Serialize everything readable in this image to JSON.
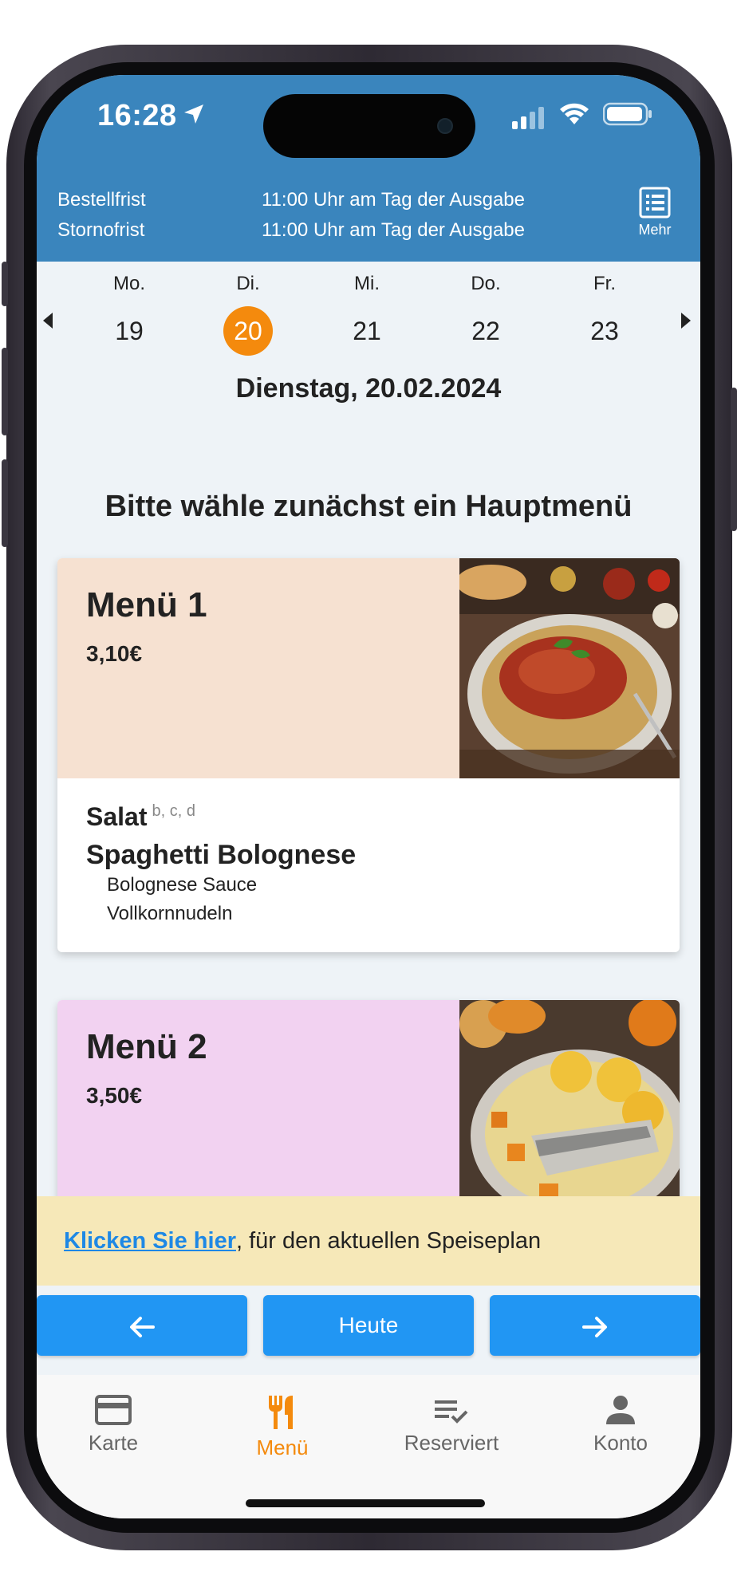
{
  "status_bar": {
    "time": "16:28"
  },
  "header": {
    "order_deadline_label": "Bestellfrist",
    "order_deadline_value": "11:00 Uhr am Tag der Ausgabe",
    "cancel_deadline_label": "Stornofrist",
    "cancel_deadline_value": "11:00 Uhr am Tag der Ausgabe",
    "more_label": "Mehr"
  },
  "week": {
    "days": [
      {
        "name": "Mo.",
        "date": "19"
      },
      {
        "name": "Di.",
        "date": "20",
        "selected": true
      },
      {
        "name": "Mi.",
        "date": "21"
      },
      {
        "name": "Do.",
        "date": "22"
      },
      {
        "name": "Fr.",
        "date": "23"
      }
    ],
    "selected_date_label": "Dienstag, 20.02.2024"
  },
  "prompt": "Bitte wähle zunächst ein Hauptmenü",
  "menus": [
    {
      "name": "Menü 1",
      "price": "3,10€",
      "color": "#f6e1d1",
      "image_icon": "spaghetti-bolognese-photo",
      "side": "Salat",
      "allergens": "b, c, d",
      "main": "Spaghetti Bolognese",
      "components": [
        "Bolognese Sauce",
        "Vollkornnudeln"
      ]
    },
    {
      "name": "Menü 2",
      "price": "3,50€",
      "color": "#f2d2f1",
      "image_icon": "fish-pumpkin-photo"
    }
  ],
  "notice": {
    "link_text": "Klicken Sie hier",
    "text": ", für den aktuellen Speiseplan"
  },
  "nav_buttons": {
    "prev_icon": "arrow-left-icon",
    "today_label": "Heute",
    "next_icon": "arrow-right-icon"
  },
  "tabs": [
    {
      "label": "Karte",
      "icon": "card-icon"
    },
    {
      "label": "Menü",
      "icon": "cutlery-icon",
      "active": true
    },
    {
      "label": "Reserviert",
      "icon": "list-check-icon"
    },
    {
      "label": "Konto",
      "icon": "person-icon"
    }
  ],
  "colors": {
    "header_blue": "#3a85bd",
    "accent_orange": "#f48a0d",
    "button_blue": "#2196f3",
    "notice_bg": "#f6e8b8"
  }
}
